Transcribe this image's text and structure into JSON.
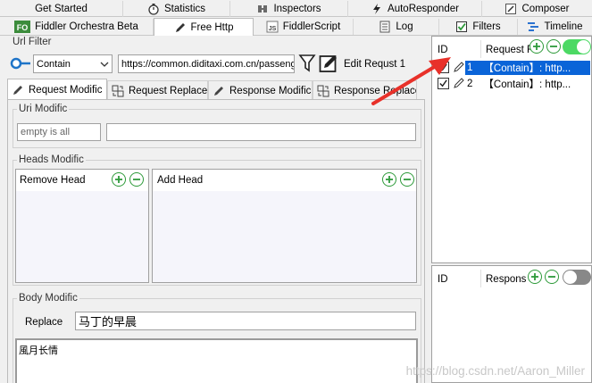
{
  "tabs_row1": [
    {
      "label": "Get Started",
      "icon": "none"
    },
    {
      "label": "Statistics",
      "icon": "stopwatch-icon"
    },
    {
      "label": "Inspectors",
      "icon": "inspectors-icon"
    },
    {
      "label": "AutoResponder",
      "icon": "lightning-icon"
    },
    {
      "label": "Composer",
      "icon": "composer-icon"
    }
  ],
  "tabs_row2": [
    {
      "label": "Fiddler Orchestra Beta",
      "icon": "fo-icon",
      "badge": "FO"
    },
    {
      "label": "Free Http",
      "icon": "pencil-icon",
      "active": true
    },
    {
      "label": "FiddlerScript",
      "icon": "js-icon",
      "badge": "JS"
    },
    {
      "label": "Log",
      "icon": "log-icon"
    },
    {
      "label": "Filters",
      "icon": "checkbox-icon"
    },
    {
      "label": "Timeline",
      "icon": "timeline-icon"
    }
  ],
  "url_filter": {
    "label": "Url Filter",
    "match_mode": "Contain",
    "url_value": "https://common.diditaxi.com.cn/passeng",
    "edit_label": "Edit Requst 1"
  },
  "subtabs": [
    {
      "label": "Request Modific",
      "icon": "pencil-icon",
      "active": true
    },
    {
      "label": "Request Replace",
      "icon": "replace-icon"
    },
    {
      "label": "Response Modific",
      "icon": "pencil-icon"
    },
    {
      "label": "Response Replace",
      "icon": "replace-icon"
    }
  ],
  "uri_modific": {
    "label": "Uri Modific",
    "placeholder_left": "empty is all",
    "value_right": ""
  },
  "heads_modific": {
    "label": "Heads Modific",
    "remove_head": "Remove Head",
    "add_head": "Add Head"
  },
  "body_modific": {
    "label": "Body Modific",
    "replace_label": "Replace",
    "replace_value": "马丁的早晨",
    "body_value": "風月长情"
  },
  "request_list": {
    "col_id": "ID",
    "col_name": "Request R",
    "rows": [
      {
        "id": "1",
        "text": "【Contain】: http...",
        "checked": true,
        "selected": true
      },
      {
        "id": "2",
        "text": "【Contain】: http...",
        "checked": true,
        "selected": false
      }
    ],
    "toggle_on": true
  },
  "response_list": {
    "col_id": "ID",
    "col_name": "Respons",
    "toggle_on": false
  },
  "colors": {
    "accent_green": "#2e9a3a",
    "toggle_on": "#4cd964",
    "toggle_off": "#888888",
    "selection_blue": "#0a64d8",
    "arrow_red": "#e8312a"
  },
  "watermark": "https://blog.csdn.net/Aaron_Miller"
}
